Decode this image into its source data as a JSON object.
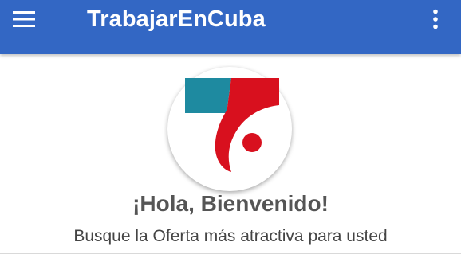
{
  "appbar": {
    "title": "TrabajarEnCuba",
    "menu_icon": "hamburger-menu-icon",
    "overflow_icon": "more-vert-icon",
    "background_color": "#3367c4"
  },
  "logo": {
    "icon": "trabajarencuba-logo",
    "colors": {
      "teal": "#1e8aa0",
      "red": "#d8101e"
    }
  },
  "main": {
    "welcome": "¡Hola, Bienvenido!",
    "subtitle": "Busque la Oferta más atractiva para usted"
  }
}
